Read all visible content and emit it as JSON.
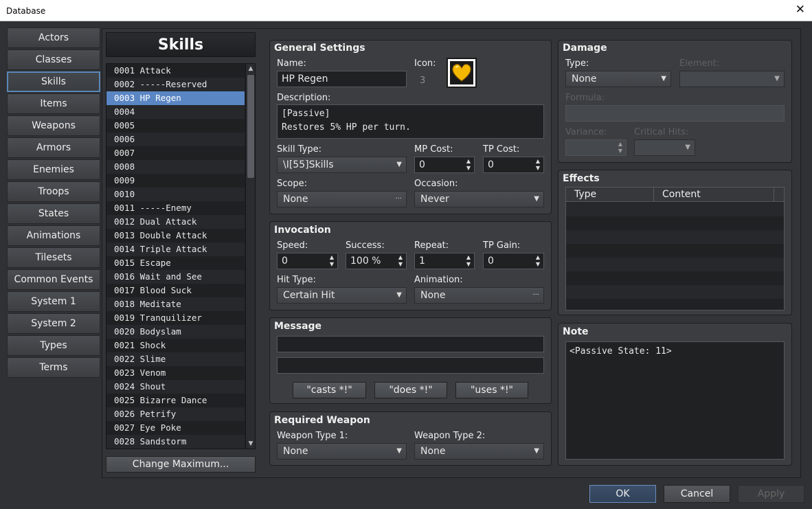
{
  "window": {
    "title": "Database",
    "close_glyph": "✕"
  },
  "categories": [
    "Actors",
    "Classes",
    "Skills",
    "Items",
    "Weapons",
    "Armors",
    "Enemies",
    "Troops",
    "States",
    "Animations",
    "Tilesets",
    "Common Events",
    "System 1",
    "System 2",
    "Types",
    "Terms"
  ],
  "selected_category": "Skills",
  "list_header": "Skills",
  "skills": [
    "0001 Attack",
    "0002 -----Reserved",
    "0003 HP Regen",
    "0004",
    "0005",
    "0006",
    "0007",
    "0008",
    "0009",
    "0010",
    "0011 -----Enemy",
    "0012 Dual Attack",
    "0013 Double Attack",
    "0014 Triple Attack",
    "0015 Escape",
    "0016 Wait and See",
    "0017 Blood Suck",
    "0018 Meditate",
    "0019 Tranquilizer",
    "0020 Bodyslam",
    "0021 Shock",
    "0022 Slime",
    "0023 Venom",
    "0024 Shout",
    "0025 Bizarre Dance",
    "0026 Petrify",
    "0027 Eye Poke",
    "0028 Sandstorm"
  ],
  "selected_skill_index": 2,
  "change_max_label": "Change Maximum...",
  "general": {
    "title": "General Settings",
    "name_label": "Name:",
    "name_value": "HP Regen",
    "icon_label": "Icon:",
    "icon_index": "3",
    "icon_name": "heart-icon",
    "icon_color": "#f5b800",
    "desc_label": "Description:",
    "desc_line1": "[Passive]",
    "desc_line2": "Restores 5% HP per turn.",
    "skill_type_label": "Skill Type:",
    "skill_type_value": "\\I[55]Skills",
    "mp_cost_label": "MP Cost:",
    "mp_cost_value": "0",
    "tp_cost_label": "TP Cost:",
    "tp_cost_value": "0",
    "scope_label": "Scope:",
    "scope_value": "None",
    "occasion_label": "Occasion:",
    "occasion_value": "Never"
  },
  "invocation": {
    "title": "Invocation",
    "speed_label": "Speed:",
    "speed_value": "0",
    "success_label": "Success:",
    "success_value": "100 %",
    "repeat_label": "Repeat:",
    "repeat_value": "1",
    "tp_gain_label": "TP Gain:",
    "tp_gain_value": "0",
    "hit_type_label": "Hit Type:",
    "hit_type_value": "Certain Hit",
    "animation_label": "Animation:",
    "animation_value": "None"
  },
  "message": {
    "title": "Message",
    "line1": "",
    "line2": "",
    "btn_casts": "\"casts *!\"",
    "btn_does": "\"does *!\"",
    "btn_uses": "\"uses *!\""
  },
  "weapon": {
    "title": "Required Weapon",
    "type1_label": "Weapon Type 1:",
    "type1_value": "None",
    "type2_label": "Weapon Type 2:",
    "type2_value": "None"
  },
  "damage": {
    "title": "Damage",
    "type_label": "Type:",
    "type_value": "None",
    "element_label": "Element:",
    "element_value": "",
    "formula_label": "Formula:",
    "formula_value": "",
    "variance_label": "Variance:",
    "variance_value": "",
    "critical_label": "Critical Hits:",
    "critical_value": ""
  },
  "effects": {
    "title": "Effects",
    "col_type": "Type",
    "col_content": "Content"
  },
  "note": {
    "title": "Note",
    "text": "<Passive State: 11>"
  },
  "buttons": {
    "ok": "OK",
    "cancel": "Cancel",
    "apply": "Apply"
  },
  "glyphs": {
    "dropdown": "▼",
    "ellipsis": "···",
    "spin_up": "▲",
    "spin_down": "▼",
    "scroll_up": "▲",
    "scroll_down": "▼"
  },
  "colors": {
    "selection": "#5a86c4",
    "ok_border": "#6b8fc0"
  }
}
